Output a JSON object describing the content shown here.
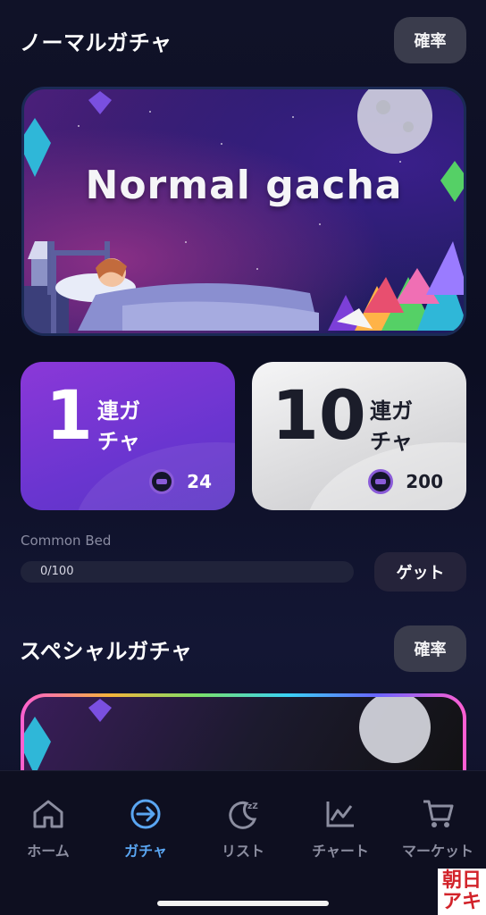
{
  "normal": {
    "title": "ノーマルガチャ",
    "rate_label": "確率",
    "banner_text": "Normal gacha"
  },
  "pulls": {
    "single": {
      "count": "1",
      "label": "連ガチャ",
      "cost": "24"
    },
    "ten": {
      "count": "10",
      "label": "連ガチャ",
      "cost": "200"
    }
  },
  "progress": {
    "name": "Common Bed",
    "text": "0/100",
    "fraction": 0,
    "get_label": "ゲット"
  },
  "special": {
    "title": "スペシャルガチャ",
    "rate_label": "確率"
  },
  "nav": {
    "items": [
      {
        "label": "ホーム",
        "icon": "home-icon",
        "active": false
      },
      {
        "label": "ガチャ",
        "icon": "gacha-arrow-icon",
        "active": true
      },
      {
        "label": "リスト",
        "icon": "sleep-moon-icon",
        "active": false
      },
      {
        "label": "チャート",
        "icon": "chart-icon",
        "active": false
      },
      {
        "label": "マーケット",
        "icon": "cart-icon",
        "active": false
      }
    ]
  },
  "colors": {
    "accent_purple": "#7b37d6",
    "active_nav": "#5aa6f2",
    "background": "#0e1024"
  }
}
